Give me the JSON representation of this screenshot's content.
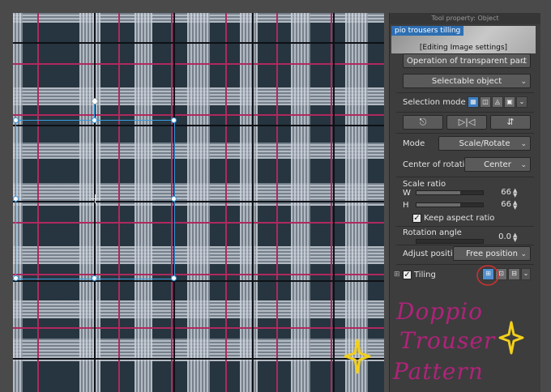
{
  "panel": {
    "title": "Tool property: Object",
    "preview_name": "pio trousers tilling",
    "preview_sub": "[Editing Image settings]",
    "transparent_dropdown": "Operation of transparent part",
    "selectable_dropdown": "Selectable object",
    "selection_mode_label": "Selection mode",
    "mode_label": "Mode",
    "mode_value": "Scale/Rotate",
    "center_label": "Center of rotation",
    "center_value": "Center",
    "scale_ratio_label": "Scale ratio",
    "w_label": "W",
    "w_value": "66",
    "w_percent": 0.66,
    "h_label": "H",
    "h_value": "66",
    "h_percent": 0.66,
    "keep_aspect_label": "Keep aspect ratio",
    "keep_aspect_checked": true,
    "rotation_label": "Rotation angle",
    "rotation_value": "0.0",
    "adjust_label": "Adjust position",
    "adjust_value": "Free position",
    "tiling_label": "Tiling",
    "tiling_checked": true
  },
  "annotation": {
    "line1": "Doppio",
    "line2": "Trouser",
    "line3": "Pattern",
    "color": "#b0237a",
    "sparkle_color": "#f2cf1b"
  },
  "colors": {
    "plaid_base": "#26353f",
    "plaid_pink": "#b0295e",
    "selection": "#3a9be0",
    "panel_bg": "#3d3d3d"
  },
  "icons": {
    "rotate": "reset-rotation-icon",
    "flip_h": "flip-horizontal-icon",
    "flip_v": "flip-vertical-icon"
  }
}
